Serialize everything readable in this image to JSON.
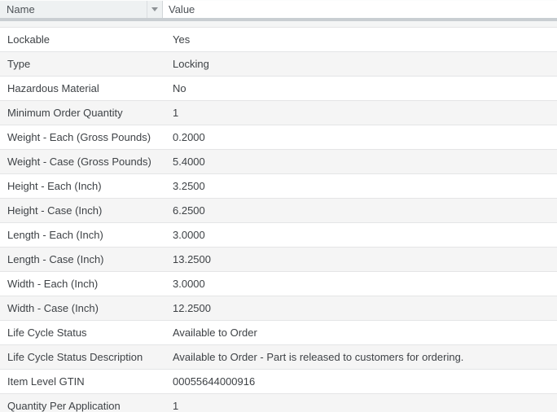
{
  "table": {
    "columns": [
      {
        "label": "Name"
      },
      {
        "label": "Value"
      }
    ],
    "rows": [
      {
        "name": "Lockable",
        "value": "Yes"
      },
      {
        "name": "Type",
        "value": "Locking"
      },
      {
        "name": "Hazardous Material",
        "value": "No"
      },
      {
        "name": "Minimum Order Quantity",
        "value": "1"
      },
      {
        "name": "Weight - Each (Gross Pounds)",
        "value": "0.2000"
      },
      {
        "name": "Weight - Case (Gross Pounds)",
        "value": "5.4000"
      },
      {
        "name": "Height - Each (Inch)",
        "value": "3.2500"
      },
      {
        "name": "Height - Case (Inch)",
        "value": "6.2500"
      },
      {
        "name": "Length - Each (Inch)",
        "value": "3.0000"
      },
      {
        "name": "Length - Case (Inch)",
        "value": "13.2500"
      },
      {
        "name": "Width - Each (Inch)",
        "value": "3.0000"
      },
      {
        "name": "Width - Case (Inch)",
        "value": "12.2500"
      },
      {
        "name": "Life Cycle Status",
        "value": "Available to Order"
      },
      {
        "name": "Life Cycle Status Description",
        "value": "Available to Order - Part is released to customers for ordering."
      },
      {
        "name": "Item Level GTIN",
        "value": "00055644000916"
      },
      {
        "name": "Quantity Per Application",
        "value": "1"
      }
    ]
  },
  "icons": {
    "name_column_filter": "caret-down-icon"
  },
  "colors": {
    "header_name_bg": "#eef1f2",
    "header_band": "#c9ced2",
    "row_alt_bg": "#f5f5f5",
    "row_border": "#e4e5e6",
    "text": "#3e4246",
    "header_text": "#4d5257"
  }
}
